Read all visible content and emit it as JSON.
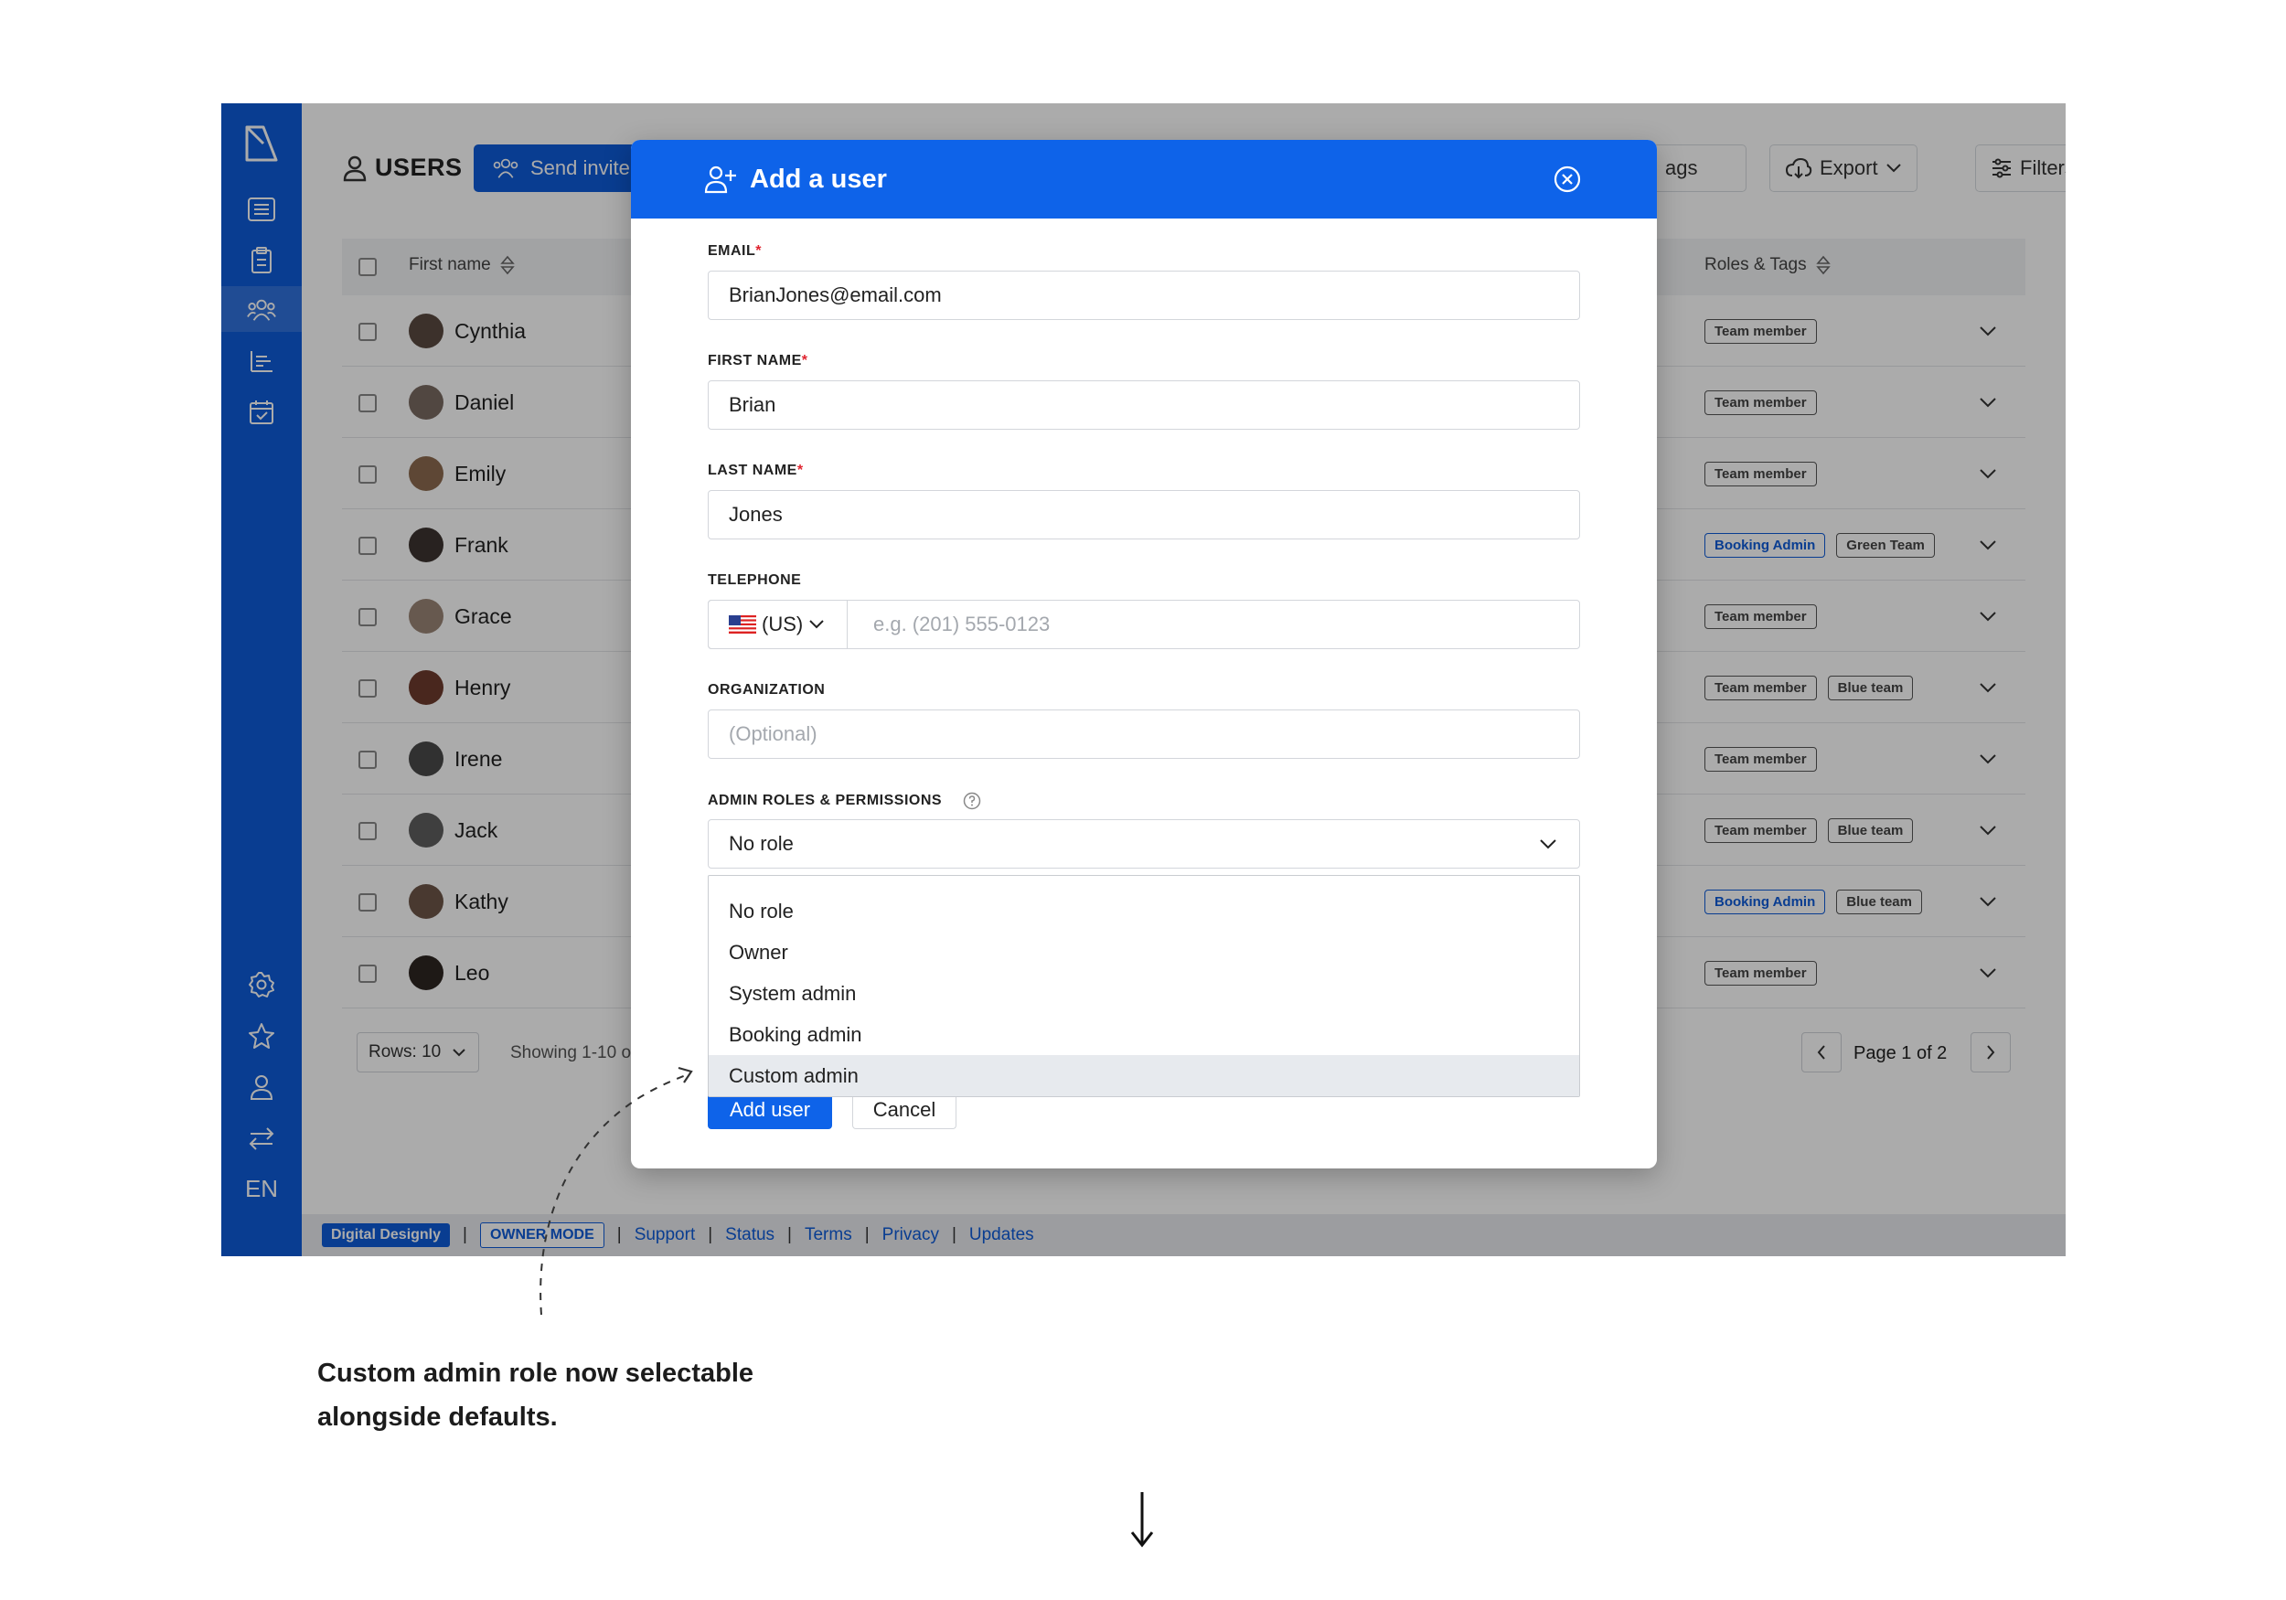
{
  "app": {
    "page_title": "USERS",
    "invite_button": "Send invite",
    "tags_button_fragment": "ags",
    "export_button": "Export",
    "filters_button": "Filters",
    "language": "EN",
    "colors": {
      "primary": "#0e5bd8",
      "modal_header": "#0e63e9",
      "required": "#e0242f"
    }
  },
  "sidebar": {
    "icons": [
      "logo-icon",
      "list-icon",
      "clipboard-icon",
      "users-icon",
      "report-icon",
      "calendar-icon",
      "settings-icon",
      "star-icon",
      "user-icon",
      "swap-icon"
    ]
  },
  "table": {
    "columns": [
      "First name",
      "Roles & Tags"
    ],
    "rows": [
      {
        "first_name": "Cynthia",
        "tags": [
          {
            "label": "Team member",
            "style": "default"
          }
        ]
      },
      {
        "first_name": "Daniel",
        "tags": [
          {
            "label": "Team member",
            "style": "default"
          }
        ]
      },
      {
        "first_name": "Emily",
        "tags": [
          {
            "label": "Team member",
            "style": "default"
          }
        ]
      },
      {
        "first_name": "Frank",
        "tags": [
          {
            "label": "Booking Admin",
            "style": "blue"
          },
          {
            "label": "Green Team",
            "style": "default"
          }
        ]
      },
      {
        "first_name": "Grace",
        "tags": [
          {
            "label": "Team member",
            "style": "default"
          }
        ]
      },
      {
        "first_name": "Henry",
        "tags": [
          {
            "label": "Team member",
            "style": "default"
          },
          {
            "label": "Blue team",
            "style": "default"
          }
        ]
      },
      {
        "first_name": "Irene",
        "tags": [
          {
            "label": "Team member",
            "style": "default"
          }
        ]
      },
      {
        "first_name": "Jack",
        "tags": [
          {
            "label": "Team member",
            "style": "default"
          },
          {
            "label": "Blue team",
            "style": "default"
          }
        ]
      },
      {
        "first_name": "Kathy",
        "tags": [
          {
            "label": "Booking Admin",
            "style": "blue"
          },
          {
            "label": "Blue team",
            "style": "default"
          }
        ]
      },
      {
        "first_name": "Leo",
        "tags": [
          {
            "label": "Team member",
            "style": "default"
          }
        ]
      }
    ]
  },
  "pagination": {
    "rows_label": "Rows: 10",
    "showing": "Showing 1-10 o",
    "page_label": "Page 1 of 2"
  },
  "footer": {
    "brand": "Digital Designly",
    "mode": "OWNER MODE",
    "links": [
      "Support",
      "Status",
      "Terms",
      "Privacy",
      "Updates"
    ]
  },
  "modal": {
    "title": "Add a user",
    "email": {
      "label": "EMAIL",
      "value": "BrianJones@email.com"
    },
    "first_name": {
      "label": "FIRST NAME",
      "value": "Brian"
    },
    "last_name": {
      "label": "LAST NAME",
      "value": "Jones"
    },
    "telephone": {
      "label": "TELEPHONE",
      "country": "(US)",
      "placeholder": "e.g. (201) 555-0123"
    },
    "organization": {
      "label": "ORGANIZATION",
      "placeholder": "(Optional)"
    },
    "roles": {
      "label": "ADMIN ROLES & PERMISSIONS",
      "selected": "No role",
      "options": [
        "No role",
        "Owner",
        "System admin",
        "Booking admin",
        "Custom admin"
      ],
      "highlighted": "Custom admin"
    },
    "add_button": "Add user",
    "cancel_button": "Cancel"
  },
  "annotation": {
    "line1": "Custom admin role now selectable",
    "line2": "alongside defaults."
  }
}
